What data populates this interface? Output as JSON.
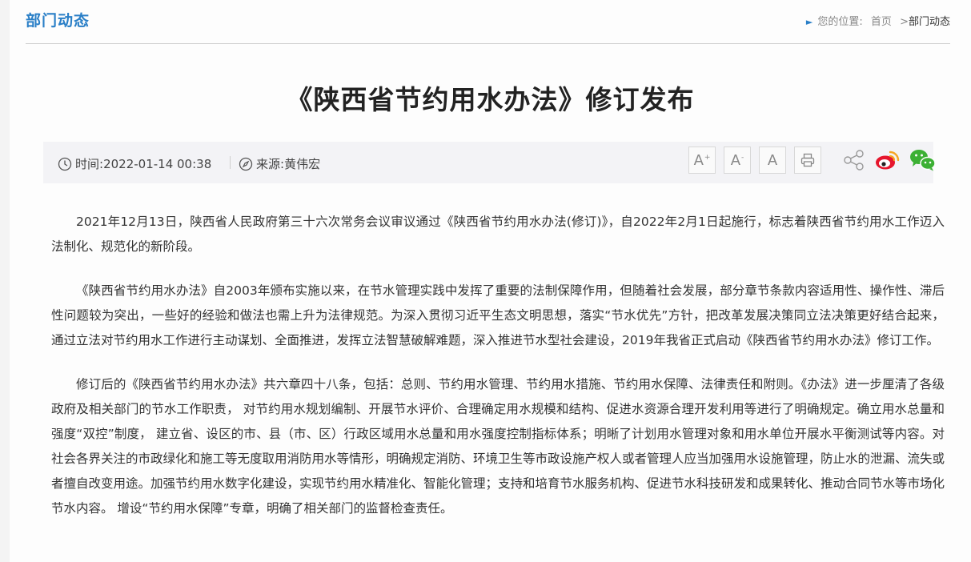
{
  "header": {
    "section_title": "部门动态",
    "breadcrumb": {
      "prefix": "您的位置:",
      "home": "首页",
      "separator": ">",
      "current": "部门动态"
    }
  },
  "article": {
    "title": "《陕西省节约用水办法》修订发布",
    "meta": {
      "time_label": "时间:",
      "time_value": "2022-01-14 00:38",
      "source_label": "来源:",
      "source_value": "黄伟宏"
    },
    "tools": {
      "font_large": "A",
      "font_large_mark": "+",
      "font_small": "A",
      "font_small_mark": "-",
      "font_reset": "A",
      "print_icon": "printer-icon"
    },
    "share_icons": [
      "share-icon",
      "weibo-icon",
      "wechat-icon"
    ],
    "paragraphs": [
      "2021年12月13日，陕西省人民政府第三十六次常务会议审议通过《陕西省节约用水办法(修订)》，自2022年2月1日起施行，标志着陕西省节约用水工作迈入法制化、规范化的新阶段。",
      "《陕西省节约用水办法》自2003年颁布实施以来，在节水管理实践中发挥了重要的法制保障作用，但随着社会发展，部分章节条款内容适用性、操作性、滞后性问题较为突出，一些好的经验和做法也需上升为法律规范。为深入贯彻习近平生态文明思想，落实“节水优先”方针，把改革发展决策同立法决策更好结合起来，通过立法对节约用水工作进行主动谋划、全面推进，发挥立法智慧破解难题，深入推进节水型社会建设，2019年我省正式启动《陕西省节约用水办法》修订工作。",
      "修订后的《陕西省节约用水办法》共六章四十八条，包括：总则、节约用水管理、节约用水措施、节约用水保障、法律责任和附则。《办法》进一步厘清了各级政府及相关部门的节水工作职责， 对节约用水规划编制、开展节水评价、合理确定用水规模和结构、促进水资源合理开发利用等进行了明确规定。确立用水总量和强度“双控”制度， 建立省、设区的市、县（市、区）行政区域用水总量和用水强度控制指标体系；明晰了计划用水管理对象和用水单位开展水平衡测试等内容。对社会各界关注的市政绿化和施工等无度取用消防用水等情形，明确规定消防、环境卫生等市政设施产权人或者管理人应当加强用水设施管理，防止水的泄漏、流失或者擅自改变用途。加强节约用水数字化建设，实现节约用水精准化、智能化管理；支持和培育节水服务机构、促进节水科技研发和成果转化、推动合同节水等市场化节水内容。 增设“节约用水保障”专章，明确了相关部门的监督检查责任。"
    ]
  },
  "colors": {
    "accent": "#2a7fc7",
    "weibo": "#e6162d",
    "weibo_orange": "#f5a623",
    "wechat": "#3cb034"
  }
}
